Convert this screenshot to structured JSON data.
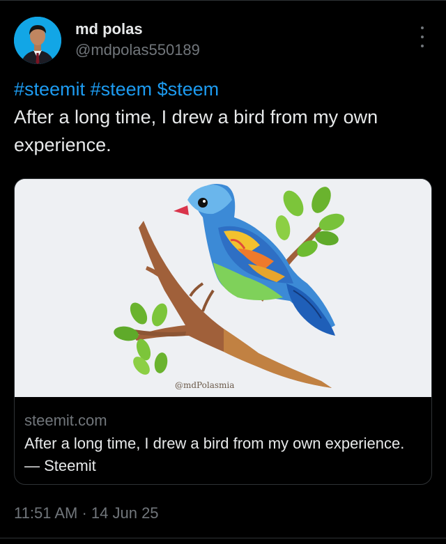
{
  "author": {
    "display_name": "md polas",
    "handle": "@mdpolas550189",
    "avatar_icon": "profile-photo"
  },
  "tweet": {
    "hashtags": [
      "#steemit",
      "#steem",
      "$steem"
    ],
    "text": "After a long time, I drew a bird from my own experience."
  },
  "card": {
    "image_signature": "@mdPolasmia",
    "domain": "steemit.com",
    "title": "After a long time, I drew a bird from my own experience. — Steemit"
  },
  "timestamp": {
    "time": "11:51 AM",
    "separator": "·",
    "date": "14 Jun 25"
  },
  "colors": {
    "background": "#000000",
    "text_primary": "#e7e9ea",
    "text_secondary": "#71767b",
    "link": "#1d9bf0",
    "border": "#2f3336"
  },
  "icons": {
    "more": "more-vertical-icon"
  }
}
